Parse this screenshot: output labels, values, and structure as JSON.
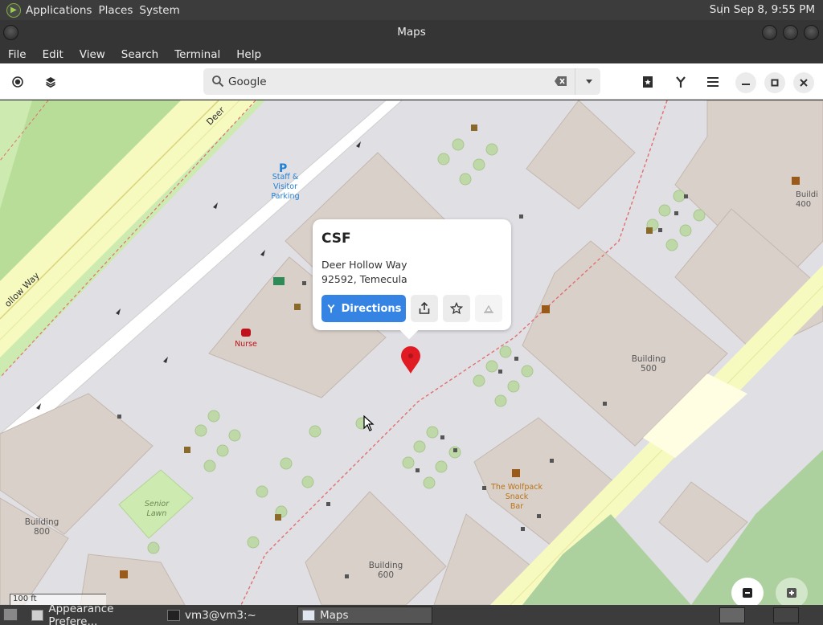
{
  "top_panel": {
    "menus": [
      "Applications",
      "Places",
      "System"
    ],
    "clock": "Sun Sep  8,  9:55 PM"
  },
  "window": {
    "title": "Maps"
  },
  "menubar": [
    "File",
    "Edit",
    "View",
    "Search",
    "Terminal",
    "Help"
  ],
  "search": {
    "value": "Google"
  },
  "map_labels": {
    "deer_road": "Deer",
    "hollow_way": "ollow Way",
    "parking": [
      "Staff &",
      "Visitor",
      "Parking"
    ],
    "nurse": "Nurse",
    "building_500": [
      "Building",
      "500"
    ],
    "building_800": [
      "Building",
      "800"
    ],
    "building_600": [
      "Building",
      "600"
    ],
    "building_400": [
      "Buildi",
      "400"
    ],
    "senior_lawn": [
      "Senior",
      "Lawn"
    ],
    "snack_bar": [
      "The Wolfpack",
      "Snack",
      "Bar"
    ]
  },
  "place": {
    "name": "CSF",
    "street": "Deer Hollow Way",
    "city": "92592, Temecula",
    "directions_label": "Directions"
  },
  "scale": "100 ft",
  "taskbar": {
    "tasks": [
      {
        "label": "Appearance Prefere..."
      },
      {
        "label": "vm3@vm3:~"
      },
      {
        "label": "Maps"
      }
    ]
  },
  "colors": {
    "accent": "#3584e4",
    "pin": "#e01b24",
    "building": "#d9d0c9",
    "road": "#f7fabf",
    "grass": "#cdebb0",
    "park": "#add19e",
    "ground": "#e0dfe4"
  }
}
